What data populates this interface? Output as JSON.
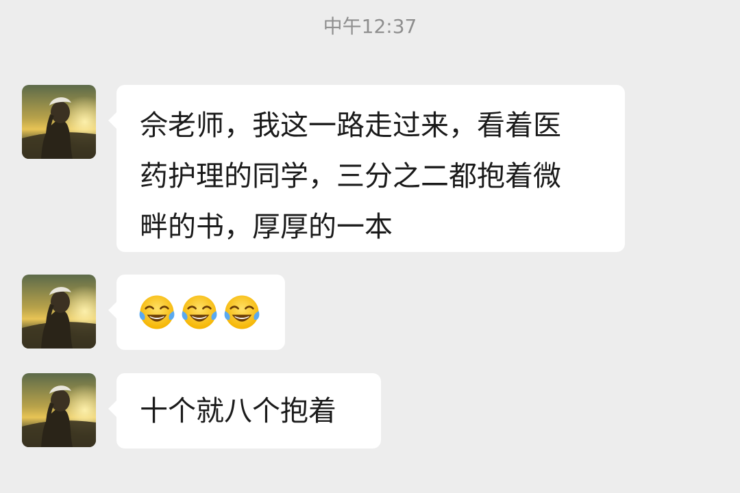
{
  "timestamp": "中午12:37",
  "messages": [
    {
      "lines": [
        "佘老师，我这一路走过来，看着医",
        "药护理的同学，三分之二都抱着微",
        "畔的书，厚厚的一本"
      ]
    },
    {
      "emojis": [
        "face-with-tears-of-joy",
        "face-with-tears-of-joy",
        "face-with-tears-of-joy"
      ]
    },
    {
      "lines": [
        "十个就八个抱着"
      ]
    }
  ],
  "colors": {
    "background": "#ededed",
    "bubble": "#ffffff",
    "text": "#1a1a1a",
    "timestamp": "#8e8e8e"
  }
}
